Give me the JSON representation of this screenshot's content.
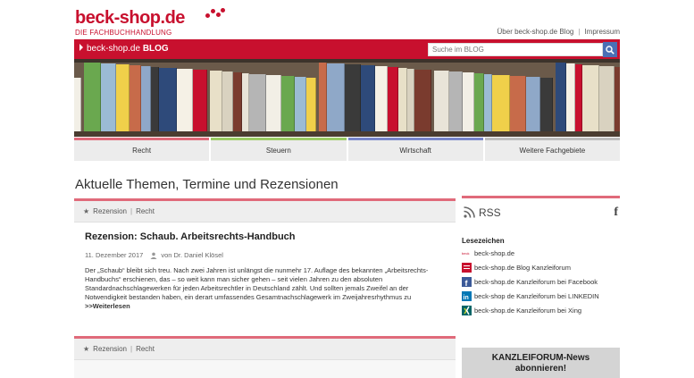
{
  "logo": {
    "main": "beck-shop.de",
    "sub": "DIE FACHBUCHHANDLUNG"
  },
  "toplinks": [
    "Über beck-shop.de Blog",
    "Impressum"
  ],
  "blog_bar": {
    "prefix": "beck-shop.de ",
    "bold": "BLOG"
  },
  "search": {
    "placeholder": "Suche im BLOG"
  },
  "tabs": [
    {
      "label": "Recht",
      "color": "#e06a7a"
    },
    {
      "label": "Steuern",
      "color": "#9ccc65"
    },
    {
      "label": "Wirtschaft",
      "color": "#7986cb"
    },
    {
      "label": "Weitere Fachgebiete",
      "color": "#bdbdbd"
    }
  ],
  "headline": "Aktuelle Themen, Termine und Rezensionen",
  "articles": [
    {
      "category": "Rezension",
      "area": "Recht",
      "title": "Rezension: Schaub. Arbeitsrechts-Handbuch",
      "date": "11. Dezember 2017",
      "author": "von Dr. Daniel Klösel",
      "text": "Der „Schaub“ bleibt sich treu. Nach zwei Jahren ist unlängst die nunmehr 17. Auflage des bekannten „Arbeitsrechts-Handbuchs“ erschienen, das – so weit kann man sicher gehen – seit vielen Jahren zu den absoluten Standardnachschlagewerken für jeden Arbeitsrechtler in Deutschland zählt. Und sollten jemals Zweifel an der Notwendigkeit bestanden haben, ein derart umfassendes Gesamtnachschlagewerk im Zweijahresrhythmus zu",
      "more": ">>Weiterlesen"
    },
    {
      "category": "Rezension",
      "area": "Recht"
    }
  ],
  "sidebar": {
    "rss": "RSS",
    "bookmarks_title": "Lesezeichen",
    "bookmarks": [
      {
        "label": "beck-shop.de",
        "icon": "beck-logo-icon"
      },
      {
        "label": "beck-shop.de Blog Kanzleiforum",
        "icon": "beck-blog-icon"
      },
      {
        "label": "beck-shop.de Kanzleiforum bei Facebook",
        "icon": "facebook-icon"
      },
      {
        "label": "beck-shop de Kanzleiforum bei LINKEDIN",
        "icon": "linkedin-icon"
      },
      {
        "label": "beck-shop.de Kanzleiforum bei Xing",
        "icon": "xing-icon"
      }
    ],
    "newsletter": {
      "line1": "KANZLEIFORUM-News",
      "line2": "abonnieren!"
    }
  }
}
